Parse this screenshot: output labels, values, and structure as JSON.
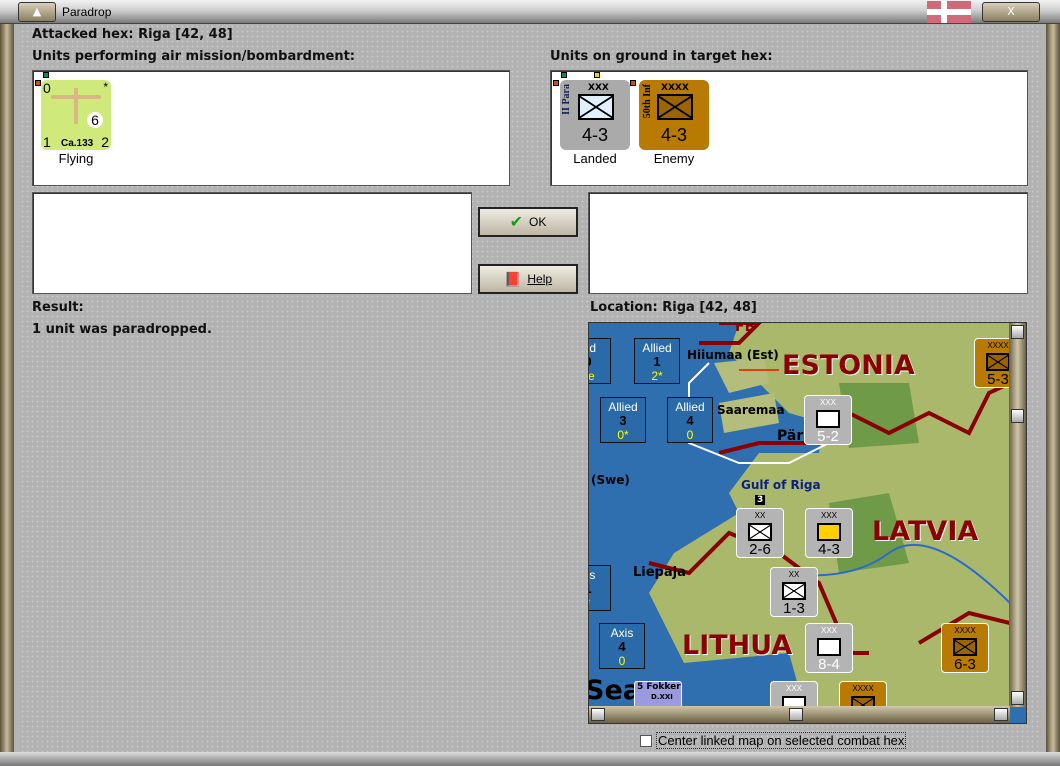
{
  "window": {
    "title": "Paradrop",
    "close": "X"
  },
  "header": {
    "attacked_hex": "Attacked hex: Riga  [42, 48]"
  },
  "air": {
    "label": "Units performing air mission/bombardment:",
    "unit": {
      "name": "Ca.133",
      "top_left": "0",
      "star": "*",
      "bomb": "6",
      "bottom_left": "1",
      "bottom_right": "2",
      "status": "Flying"
    }
  },
  "ground": {
    "label": "Units on ground in target hex:",
    "units": [
      {
        "name": "II Para",
        "size": "XXX",
        "strength": "4-3",
        "status": "Landed"
      },
      {
        "name": "50th Inf",
        "size": "XXXX",
        "strength": "4-3",
        "status": "Enemy"
      }
    ]
  },
  "buttons": {
    "ok": "OK",
    "help": "Help"
  },
  "result": {
    "label": "Result:",
    "text": "1 unit was paradropped."
  },
  "location": {
    "label": "Location:  Riga  [42, 48]"
  },
  "map": {
    "countries": [
      "ESTONIA",
      "LATVIA",
      "LITHUA"
    ],
    "places": [
      "Hiiumaa (Est)",
      "Saaremaa",
      "Pär",
      "Gulf of Riga",
      "(Swe)",
      "Liepaja",
      "Sea",
      "FB"
    ],
    "boxes": [
      {
        "a": "ied",
        "b": "0",
        "c": "ne"
      },
      {
        "a": "Allied",
        "b": "1",
        "c": "2*"
      },
      {
        "a": "Allied",
        "b": "3",
        "c": "0*"
      },
      {
        "a": "Allied",
        "b": "4",
        "c": "0"
      },
      {
        "a": "xis",
        "b": "1",
        "c": "*"
      },
      {
        "a": "Axis",
        "b": "4",
        "c": "0"
      }
    ],
    "counters": [
      {
        "size": "XXX",
        "strength": "5-2"
      },
      {
        "size": "XX",
        "strength": "2-6"
      },
      {
        "size": "XXX",
        "strength": "4-3"
      },
      {
        "size": "XX",
        "strength": "1-3"
      },
      {
        "size": "XXX",
        "strength": "8-4"
      },
      {
        "size": "XXXX",
        "strength": "6-3"
      },
      {
        "size": "XXXX",
        "strength": "5-3"
      },
      {
        "size": "XXX",
        "strength": ""
      },
      {
        "size": "XXXX",
        "strength": ""
      }
    ],
    "stack_badge": "3",
    "air_unit": {
      "num": "5",
      "name": "Fokker",
      "model": "D.XXI"
    }
  },
  "checkbox": {
    "label": "Center linked map on selected combat hex",
    "checked": false
  }
}
